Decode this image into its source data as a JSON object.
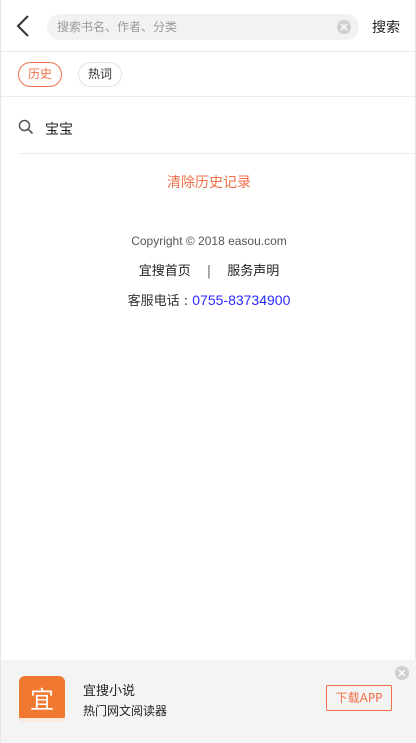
{
  "header": {
    "back_icon": "chevron-left-icon",
    "search_placeholder": "搜索书名、作者、分类",
    "search_value": "",
    "clear_icon": "close-icon",
    "search_button": "搜索"
  },
  "tabs": [
    {
      "label": "历史",
      "active": true
    },
    {
      "label": "热词",
      "active": false
    }
  ],
  "history": {
    "items": [
      {
        "icon": "search-icon",
        "label": "宝宝"
      }
    ],
    "clear_label": "清除历史记录"
  },
  "footer": {
    "copyright": "Copyright © 2018 easou.com",
    "links": [
      "宜搜首页",
      "服务声明"
    ],
    "separator": "|",
    "service_label": "客服电话 : ",
    "service_phone": "0755-83734900"
  },
  "banner": {
    "logo_text": "宜",
    "app_name": "宜搜小说",
    "app_desc": "热门网文阅读器",
    "download_label": "下载APP",
    "close_icon": "close-icon"
  },
  "colors": {
    "accent": "#f07048",
    "logo": "#f07830",
    "phone": "#2a2aff"
  }
}
